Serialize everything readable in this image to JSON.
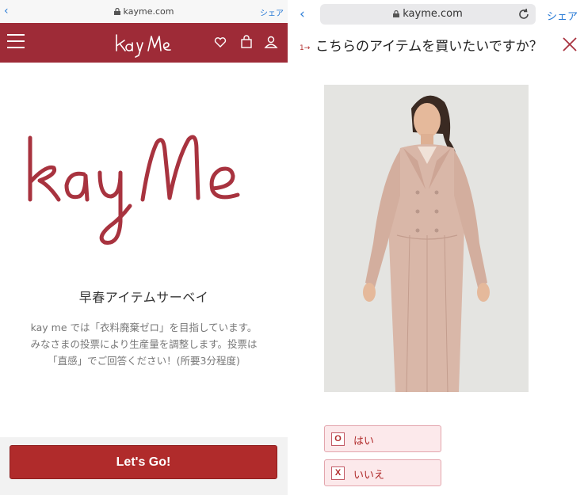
{
  "left": {
    "url": "kayme.com",
    "share": "シェア",
    "survey_title": "早春アイテムサーベイ",
    "survey_desc_lines": [
      "kay me では「衣料廃棄ゼロ」を目指しています。",
      "みなさまの投票により生産量を調整します。投票は",
      "「直感」でご回答ください！(所要3分程度)"
    ],
    "go_button": "Let's Go!"
  },
  "right": {
    "url": "kayme.com",
    "share": "シェア",
    "question_number": "1→",
    "question": "こちらのアイテムを買いたいですか？",
    "choices": [
      {
        "key": "O",
        "label": "はい"
      },
      {
        "key": "X",
        "label": "いいえ"
      }
    ]
  },
  "colors": {
    "brand": "#9e2b37",
    "button": "#b02b2b",
    "link": "#2a7bd6"
  }
}
